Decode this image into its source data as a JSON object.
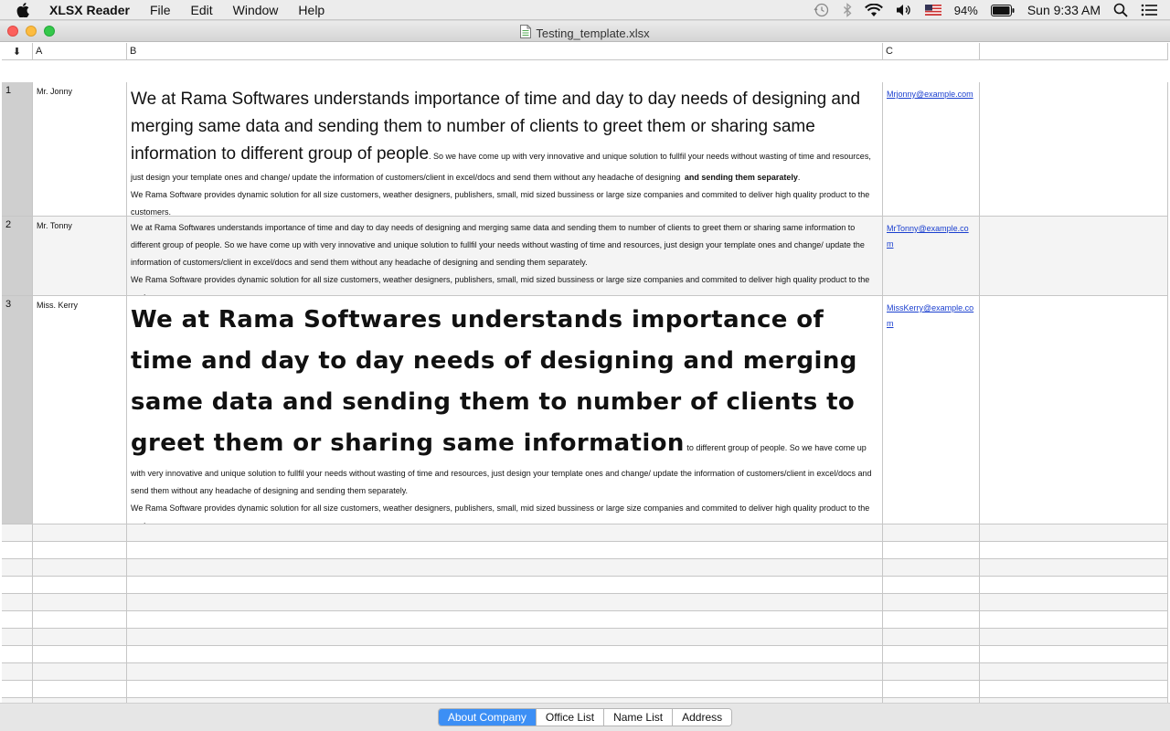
{
  "menubar": {
    "app_name": "XLSX Reader",
    "items": [
      "File",
      "Edit",
      "Window",
      "Help"
    ],
    "battery": "94%",
    "clock": "Sun 9:33 AM"
  },
  "window": {
    "title": "Testing_template.xlsx"
  },
  "columns": {
    "corner": "⬇",
    "a": "A",
    "b": "B",
    "c": "C"
  },
  "rows": [
    {
      "num": "1",
      "name": "Mr. Jonny",
      "email": "Mrjonny@example.com",
      "text_big": "We at Rama Softwares understands importance of time and day to day needs of designing and merging same data and sending them to number of clients to greet them or sharing same information to different group of people",
      "text_small": ". So we have come up with very innovative and unique solution to fullfil your needs without wasting of time and resources, just design your template ones and change/ update the information of customers/client in excel/docs and send them without any headache of designing",
      "text_bold": "and sending them separately",
      "text_end": ".",
      "text_para2": "We Rama Software provides dynamic solution for all size customers, weather designers, publishers, small, mid sized bussiness or large size companies and commited to deliver high quality product to the customers."
    },
    {
      "num": "2",
      "name": "Mr. Tonny",
      "email": "MrTonny@example.com",
      "text_small": "We at Rama Softwares understands importance of time and day to day needs of designing and merging same data and sending them to number of clients to greet them or sharing same information to different group of people. So we have come up with very innovative and unique solution to fullfil your needs without wasting of time and resources, just design your template ones and change/ update the information of customers/client in excel/docs and send them without any headache of designing and sending them separately.",
      "text_para2": "We Rama Software provides dynamic solution for all size customers, weather designers, publishers, small, mid sized bussiness or large size companies and commited to deliver high quality product to the customers."
    },
    {
      "num": "3",
      "name": "Miss. Kerry",
      "email": "MissKerry@example.com",
      "text_big": "We at Rama Softwares understands importance of time and day to day needs of designing and merging same data and sending them to number of clients to greet them or sharing same information",
      "text_small": " to different group of people. So we have come up with very innovative and unique solution to fullfil your needs without wasting of time and resources, just design your template ones and change/ update the information of customers/client in excel/docs and send them without any headache of designing and sending them separately.",
      "text_para2": "We Rama Software provides dynamic solution for all size customers, weather designers, publishers, small, mid sized bussiness or large size companies and commited to deliver high quality product to the customers."
    }
  ],
  "tabs": [
    {
      "label": "About Company",
      "active": true
    },
    {
      "label": "Office List",
      "active": false
    },
    {
      "label": "Name List",
      "active": false
    },
    {
      "label": "Address",
      "active": false
    }
  ]
}
